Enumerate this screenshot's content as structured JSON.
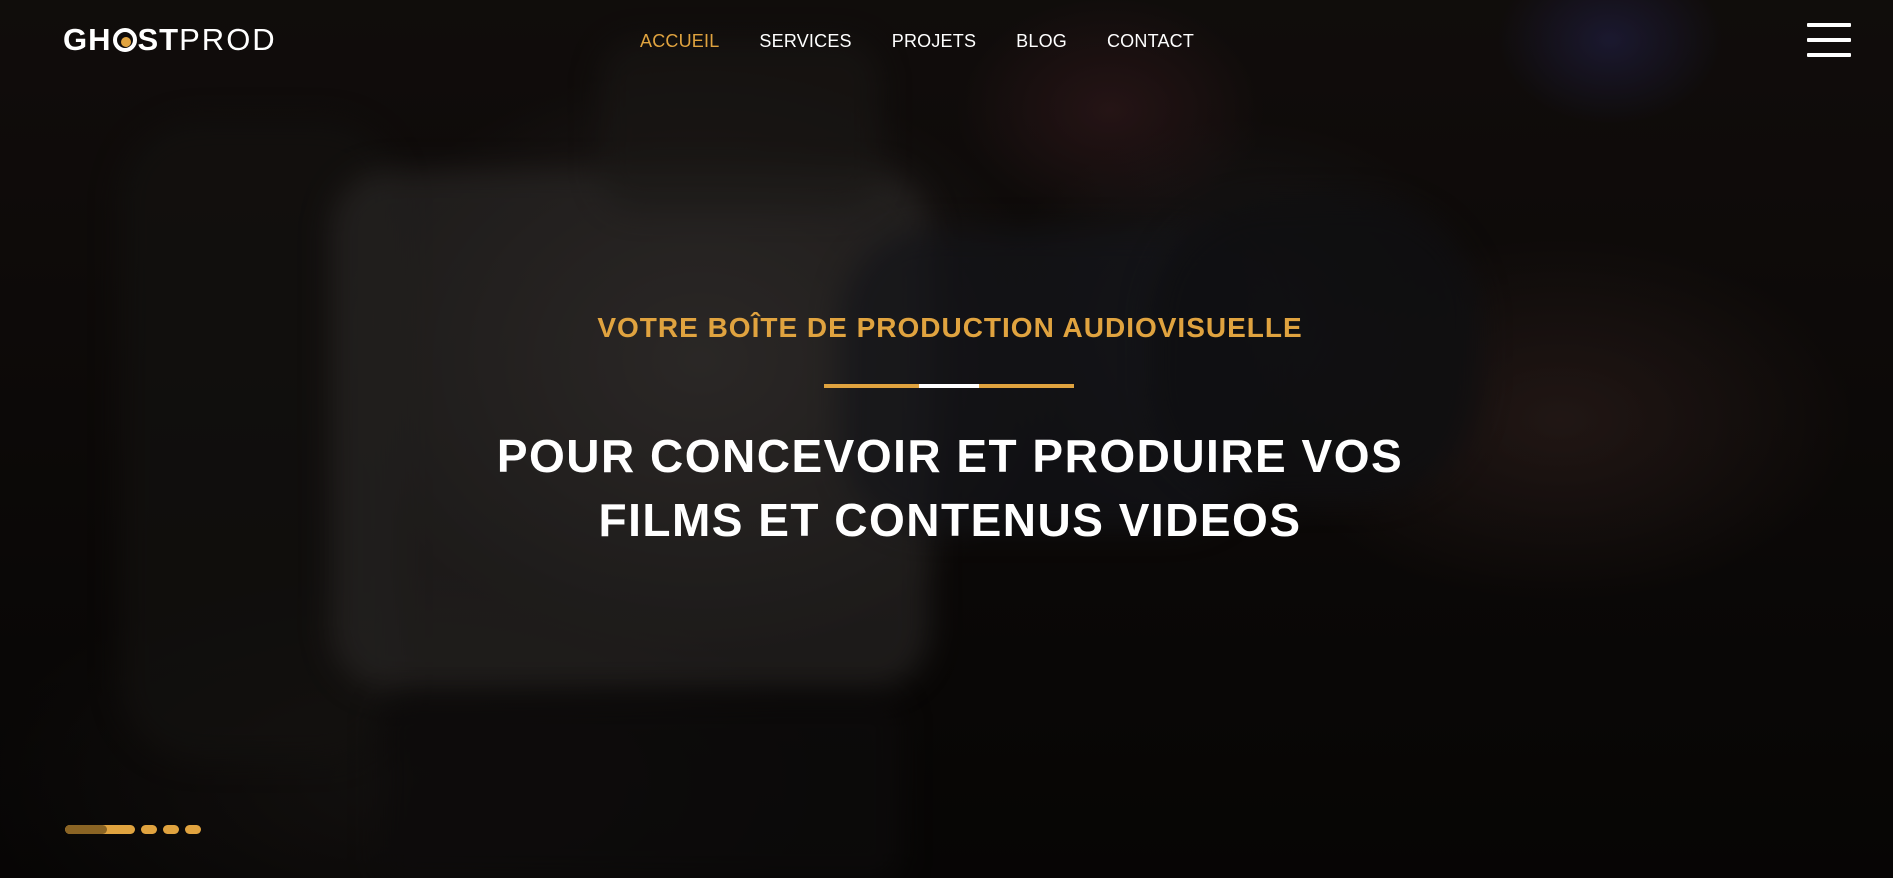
{
  "brand": {
    "logo_bold_prefix": "GH",
    "logo_bold_suffix": "ST",
    "logo_light": "PROD",
    "accent_color": "#e0a33f"
  },
  "nav": {
    "items": [
      {
        "label": "ACCUEIL",
        "active": true
      },
      {
        "label": "SERVICES",
        "active": false
      },
      {
        "label": "PROJETS",
        "active": false
      },
      {
        "label": "BLOG",
        "active": false
      },
      {
        "label": "CONTACT",
        "active": false
      }
    ],
    "menu_icon": "hamburger-menu-icon"
  },
  "hero": {
    "kicker": "VOTRE BOÎTE DE PRODUCTION AUDIOVISUELLE",
    "headline_line1": "POUR CONCEVOIR ET PRODUIRE VOS",
    "headline_line2": "FILMS ET CONTENUS VIDEOS"
  },
  "slider": {
    "slide_count": 4,
    "active_index": 0,
    "active_progress": 0.6
  }
}
